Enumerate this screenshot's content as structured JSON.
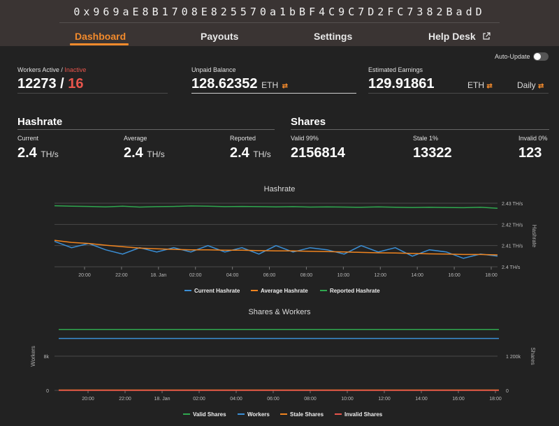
{
  "wallet": "0x969aE8B1708E825570a1bBF4C9C7D2FC7382BadD",
  "nav": {
    "dashboard": "Dashboard",
    "payouts": "Payouts",
    "settings": "Settings",
    "help": "Help Desk"
  },
  "auto_update": {
    "label": "Auto-Update",
    "enabled": false
  },
  "workers": {
    "label": "Workers Active",
    "sep": " / ",
    "inactive_label": "Inactive",
    "active": "12273",
    "slash": " / ",
    "inactive": "16"
  },
  "unpaid": {
    "label": "Unpaid Balance",
    "value": "128.62352",
    "unit": "ETH"
  },
  "estimated": {
    "label": "Estimated Earnings",
    "value": "129.91861",
    "unit": "ETH",
    "period": "Daily"
  },
  "hashrate": {
    "title": "Hashrate",
    "current": {
      "label": "Current",
      "value": "2.4",
      "unit": "TH/s"
    },
    "average": {
      "label": "Average",
      "value": "2.4",
      "unit": "TH/s"
    },
    "reported": {
      "label": "Reported",
      "value": "2.4",
      "unit": "TH/s"
    }
  },
  "shares": {
    "title": "Shares",
    "valid": {
      "label": "Valid 99%",
      "value": "2156814"
    },
    "stale": {
      "label": "Stale 1%",
      "value": "13322"
    },
    "invalid": {
      "label": "Invalid 0%",
      "value": "123"
    }
  },
  "colors": {
    "accent": "#f28a2c",
    "current": "#3b8fd6",
    "average": "#f0841f",
    "reported": "#2fa84f",
    "inactive": "#e8554c"
  },
  "chart_data": [
    {
      "type": "line",
      "title": "Hashrate",
      "ylabel": "Hashrate",
      "x": [
        "20:00",
        "22:00",
        "18. Jan",
        "02:00",
        "04:00",
        "06:00",
        "08:00",
        "10:00",
        "12:00",
        "14:00",
        "16:00",
        "18:00"
      ],
      "y_ticks": [
        "2.43 TH/s",
        "2.42 TH/s",
        "2.41 TH/s",
        "2.4 TH/s"
      ],
      "ylim": [
        2.4,
        2.43
      ],
      "series": [
        {
          "name": "Current Hashrate",
          "color": "#3b8fd6",
          "values": [
            2.412,
            2.409,
            2.411,
            2.408,
            2.406,
            2.409,
            2.407,
            2.409,
            2.407,
            2.41,
            2.407,
            2.409,
            2.406,
            2.41,
            2.407,
            2.409,
            2.408,
            2.406,
            2.41,
            2.407,
            2.409,
            2.405,
            2.408,
            2.407,
            2.404,
            2.406,
            2.405
          ]
        },
        {
          "name": "Average Hashrate",
          "color": "#f0841f",
          "values": [
            2.4125,
            2.4115,
            2.411,
            2.4102,
            2.4095,
            2.4088,
            2.4085,
            2.4082,
            2.408,
            2.408,
            2.4078,
            2.4078,
            2.4076,
            2.4075,
            2.4075,
            2.4073,
            2.4072,
            2.407,
            2.4068,
            2.4066,
            2.4065,
            2.4063,
            2.4061,
            2.406,
            2.4058,
            2.4058,
            2.4056
          ]
        },
        {
          "name": "Reported Hashrate",
          "color": "#2fa84f",
          "values": [
            2.4288,
            2.4286,
            2.4285,
            2.4283,
            2.4286,
            2.4282,
            2.4284,
            2.4285,
            2.4287,
            2.4286,
            2.4284,
            2.4285,
            2.4284,
            2.4283,
            2.4284,
            2.4282,
            2.4283,
            2.4282,
            2.4281,
            2.4283,
            2.4281,
            2.428,
            2.4281,
            2.428,
            2.4279,
            2.4281,
            2.4276
          ]
        }
      ],
      "legend": "bottom"
    },
    {
      "type": "line",
      "title": "Shares & Workers",
      "ylabel_left": "Workers",
      "ylabel_right": "Shares",
      "x": [
        "20:00",
        "22:00",
        "18. Jan",
        "02:00",
        "04:00",
        "06:00",
        "08:00",
        "10:00",
        "12:00",
        "14:00",
        "16:00",
        "18:00"
      ],
      "y_left_ticks": [
        "8k",
        "0"
      ],
      "y_right_ticks": [
        "1 200k",
        "0"
      ],
      "series": [
        {
          "name": "Valid Shares",
          "color": "#2fa84f",
          "axis": "right",
          "values": [
            2156814,
            2156814
          ]
        },
        {
          "name": "Workers",
          "color": "#3b8fd6",
          "axis": "left",
          "values": [
            12273,
            12273
          ]
        },
        {
          "name": "Stale Shares",
          "color": "#f0841f",
          "axis": "right",
          "values": [
            13322,
            13322
          ]
        },
        {
          "name": "Invalid Shares",
          "color": "#e8554c",
          "axis": "right",
          "values": [
            123,
            123
          ]
        }
      ],
      "legend": "bottom"
    }
  ]
}
